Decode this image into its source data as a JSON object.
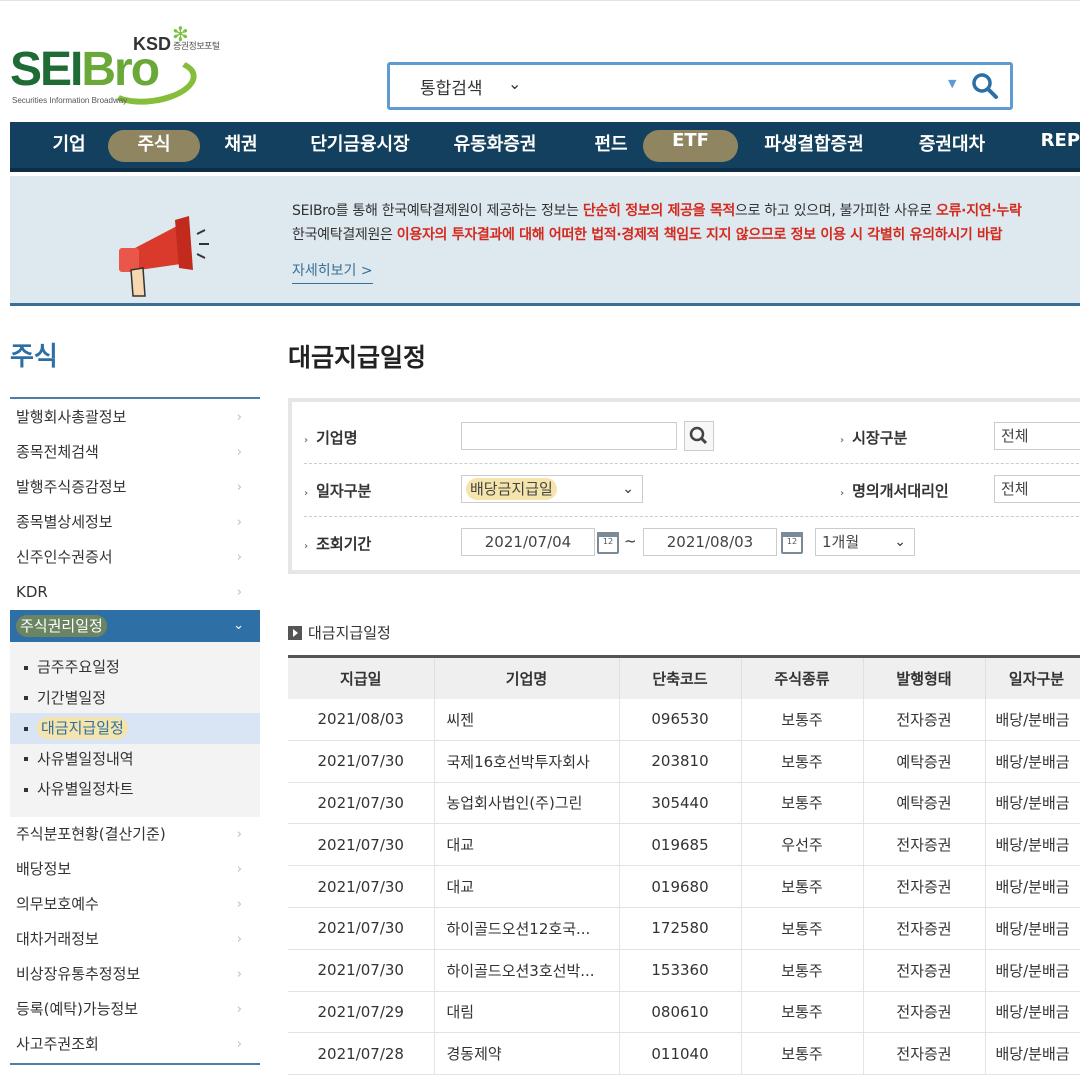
{
  "logo": {
    "ksd": "KSD",
    "ksd_sub": "증권정보포털",
    "word_a": "SEI",
    "word_b": "Bro",
    "tagline": "Securities Information Broadway"
  },
  "search": {
    "category": "통합검색",
    "value": ""
  },
  "nav": [
    "기업",
    "주식",
    "채권",
    "단기금융시장",
    "유동화증권",
    "펀드",
    "ETF",
    "파생결합증권",
    "증권대차",
    "REPO"
  ],
  "notice": {
    "l1_a": "SEIBro를 통해 한국예탁결제원이 제공하는 정보는 ",
    "l1_red": "단순히 정보의 제공을 목적",
    "l1_b": "으로 하고 있으며, 불가피한 사유로 ",
    "l1_red2": "오류·지연·누락",
    "l2_a": "한국예탁결제원은 ",
    "l2_red": "이용자의 투자결과에 대해 어떠한 법적·경제적 책임도 지지 않으므로 정보 이용 시 각별히 유의하시기 바랍",
    "more": "자세히보기 >"
  },
  "sidebar": {
    "title": "주식",
    "items_top": [
      "발행회사총괄정보",
      "종목전체검색",
      "발행주식증감정보",
      "종목별상세정보",
      "신주인수권증서",
      "KDR"
    ],
    "open_item": "주식권리일정",
    "sub_items": [
      "금주주요일정",
      "기간별일정",
      "대금지급일정",
      "사유별일정내역",
      "사유별일정차트"
    ],
    "items_bottom": [
      "주식분포현황(결산기준)",
      "배당정보",
      "의무보호예수",
      "대차거래정보",
      "비상장유통추정정보",
      "등록(예탁)가능정보",
      "사고주권조회"
    ]
  },
  "page": {
    "title": "대금지급일정",
    "section": "대금지급일정"
  },
  "filter": {
    "company_label": "기업명",
    "company_value": "",
    "market_label": "시장구분",
    "market_value": "전체",
    "date_type_label": "일자구분",
    "date_type_value": "배당금지급일",
    "agent_label": "명의개서대리인",
    "agent_value": "전체",
    "period_label": "조회기간",
    "date_from": "2021/07/04",
    "tilde": "~",
    "date_to": "2021/08/03",
    "period_value": "1개월",
    "cal_day": "12"
  },
  "table": {
    "headers": [
      "지급일",
      "기업명",
      "단축코드",
      "주식종류",
      "발행형태",
      "일자구분"
    ],
    "rows": [
      [
        "2021/08/03",
        "씨젠",
        "096530",
        "보통주",
        "전자증권",
        "배당/분배금"
      ],
      [
        "2021/07/30",
        "국제16호선박투자회사",
        "203810",
        "보통주",
        "예탁증권",
        "배당/분배금"
      ],
      [
        "2021/07/30",
        "농업회사법인(주)그린",
        "305440",
        "보통주",
        "예탁증권",
        "배당/분배금"
      ],
      [
        "2021/07/30",
        "대교",
        "019685",
        "우선주",
        "전자증권",
        "배당/분배금"
      ],
      [
        "2021/07/30",
        "대교",
        "019680",
        "보통주",
        "전자증권",
        "배당/분배금"
      ],
      [
        "2021/07/30",
        "하이골드오션12호국...",
        "172580",
        "보통주",
        "전자증권",
        "배당/분배금"
      ],
      [
        "2021/07/30",
        "하이골드오션3호선박...",
        "153360",
        "보통주",
        "전자증권",
        "배당/분배금"
      ],
      [
        "2021/07/29",
        "대림",
        "080610",
        "보통주",
        "전자증권",
        "배당/분배금"
      ],
      [
        "2021/07/28",
        "경동제약",
        "011040",
        "보통주",
        "전자증권",
        "배당/분배금"
      ]
    ]
  }
}
